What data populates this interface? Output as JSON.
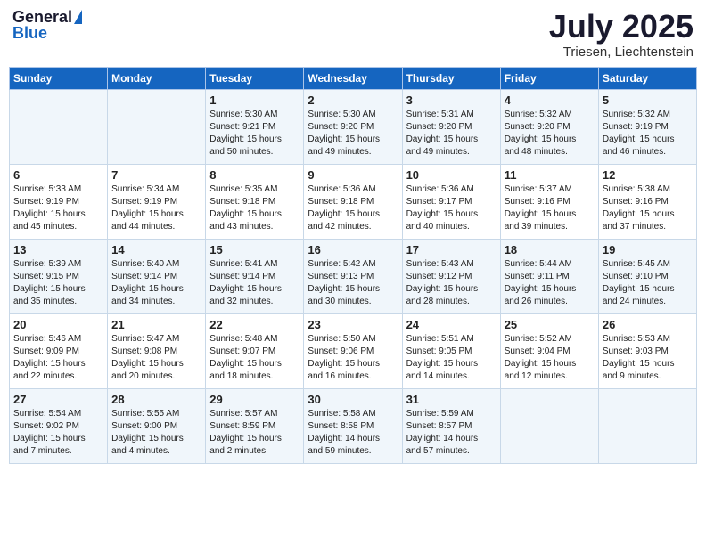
{
  "header": {
    "logo_general": "General",
    "logo_blue": "Blue",
    "title": "July 2025",
    "location": "Triesen, Liechtenstein"
  },
  "days_of_week": [
    "Sunday",
    "Monday",
    "Tuesday",
    "Wednesday",
    "Thursday",
    "Friday",
    "Saturday"
  ],
  "weeks": [
    [
      {
        "day": "",
        "info": ""
      },
      {
        "day": "",
        "info": ""
      },
      {
        "day": "1",
        "info": "Sunrise: 5:30 AM\nSunset: 9:21 PM\nDaylight: 15 hours\nand 50 minutes."
      },
      {
        "day": "2",
        "info": "Sunrise: 5:30 AM\nSunset: 9:20 PM\nDaylight: 15 hours\nand 49 minutes."
      },
      {
        "day": "3",
        "info": "Sunrise: 5:31 AM\nSunset: 9:20 PM\nDaylight: 15 hours\nand 49 minutes."
      },
      {
        "day": "4",
        "info": "Sunrise: 5:32 AM\nSunset: 9:20 PM\nDaylight: 15 hours\nand 48 minutes."
      },
      {
        "day": "5",
        "info": "Sunrise: 5:32 AM\nSunset: 9:19 PM\nDaylight: 15 hours\nand 46 minutes."
      }
    ],
    [
      {
        "day": "6",
        "info": "Sunrise: 5:33 AM\nSunset: 9:19 PM\nDaylight: 15 hours\nand 45 minutes."
      },
      {
        "day": "7",
        "info": "Sunrise: 5:34 AM\nSunset: 9:19 PM\nDaylight: 15 hours\nand 44 minutes."
      },
      {
        "day": "8",
        "info": "Sunrise: 5:35 AM\nSunset: 9:18 PM\nDaylight: 15 hours\nand 43 minutes."
      },
      {
        "day": "9",
        "info": "Sunrise: 5:36 AM\nSunset: 9:18 PM\nDaylight: 15 hours\nand 42 minutes."
      },
      {
        "day": "10",
        "info": "Sunrise: 5:36 AM\nSunset: 9:17 PM\nDaylight: 15 hours\nand 40 minutes."
      },
      {
        "day": "11",
        "info": "Sunrise: 5:37 AM\nSunset: 9:16 PM\nDaylight: 15 hours\nand 39 minutes."
      },
      {
        "day": "12",
        "info": "Sunrise: 5:38 AM\nSunset: 9:16 PM\nDaylight: 15 hours\nand 37 minutes."
      }
    ],
    [
      {
        "day": "13",
        "info": "Sunrise: 5:39 AM\nSunset: 9:15 PM\nDaylight: 15 hours\nand 35 minutes."
      },
      {
        "day": "14",
        "info": "Sunrise: 5:40 AM\nSunset: 9:14 PM\nDaylight: 15 hours\nand 34 minutes."
      },
      {
        "day": "15",
        "info": "Sunrise: 5:41 AM\nSunset: 9:14 PM\nDaylight: 15 hours\nand 32 minutes."
      },
      {
        "day": "16",
        "info": "Sunrise: 5:42 AM\nSunset: 9:13 PM\nDaylight: 15 hours\nand 30 minutes."
      },
      {
        "day": "17",
        "info": "Sunrise: 5:43 AM\nSunset: 9:12 PM\nDaylight: 15 hours\nand 28 minutes."
      },
      {
        "day": "18",
        "info": "Sunrise: 5:44 AM\nSunset: 9:11 PM\nDaylight: 15 hours\nand 26 minutes."
      },
      {
        "day": "19",
        "info": "Sunrise: 5:45 AM\nSunset: 9:10 PM\nDaylight: 15 hours\nand 24 minutes."
      }
    ],
    [
      {
        "day": "20",
        "info": "Sunrise: 5:46 AM\nSunset: 9:09 PM\nDaylight: 15 hours\nand 22 minutes."
      },
      {
        "day": "21",
        "info": "Sunrise: 5:47 AM\nSunset: 9:08 PM\nDaylight: 15 hours\nand 20 minutes."
      },
      {
        "day": "22",
        "info": "Sunrise: 5:48 AM\nSunset: 9:07 PM\nDaylight: 15 hours\nand 18 minutes."
      },
      {
        "day": "23",
        "info": "Sunrise: 5:50 AM\nSunset: 9:06 PM\nDaylight: 15 hours\nand 16 minutes."
      },
      {
        "day": "24",
        "info": "Sunrise: 5:51 AM\nSunset: 9:05 PM\nDaylight: 15 hours\nand 14 minutes."
      },
      {
        "day": "25",
        "info": "Sunrise: 5:52 AM\nSunset: 9:04 PM\nDaylight: 15 hours\nand 12 minutes."
      },
      {
        "day": "26",
        "info": "Sunrise: 5:53 AM\nSunset: 9:03 PM\nDaylight: 15 hours\nand 9 minutes."
      }
    ],
    [
      {
        "day": "27",
        "info": "Sunrise: 5:54 AM\nSunset: 9:02 PM\nDaylight: 15 hours\nand 7 minutes."
      },
      {
        "day": "28",
        "info": "Sunrise: 5:55 AM\nSunset: 9:00 PM\nDaylight: 15 hours\nand 4 minutes."
      },
      {
        "day": "29",
        "info": "Sunrise: 5:57 AM\nSunset: 8:59 PM\nDaylight: 15 hours\nand 2 minutes."
      },
      {
        "day": "30",
        "info": "Sunrise: 5:58 AM\nSunset: 8:58 PM\nDaylight: 14 hours\nand 59 minutes."
      },
      {
        "day": "31",
        "info": "Sunrise: 5:59 AM\nSunset: 8:57 PM\nDaylight: 14 hours\nand 57 minutes."
      },
      {
        "day": "",
        "info": ""
      },
      {
        "day": "",
        "info": ""
      }
    ]
  ]
}
